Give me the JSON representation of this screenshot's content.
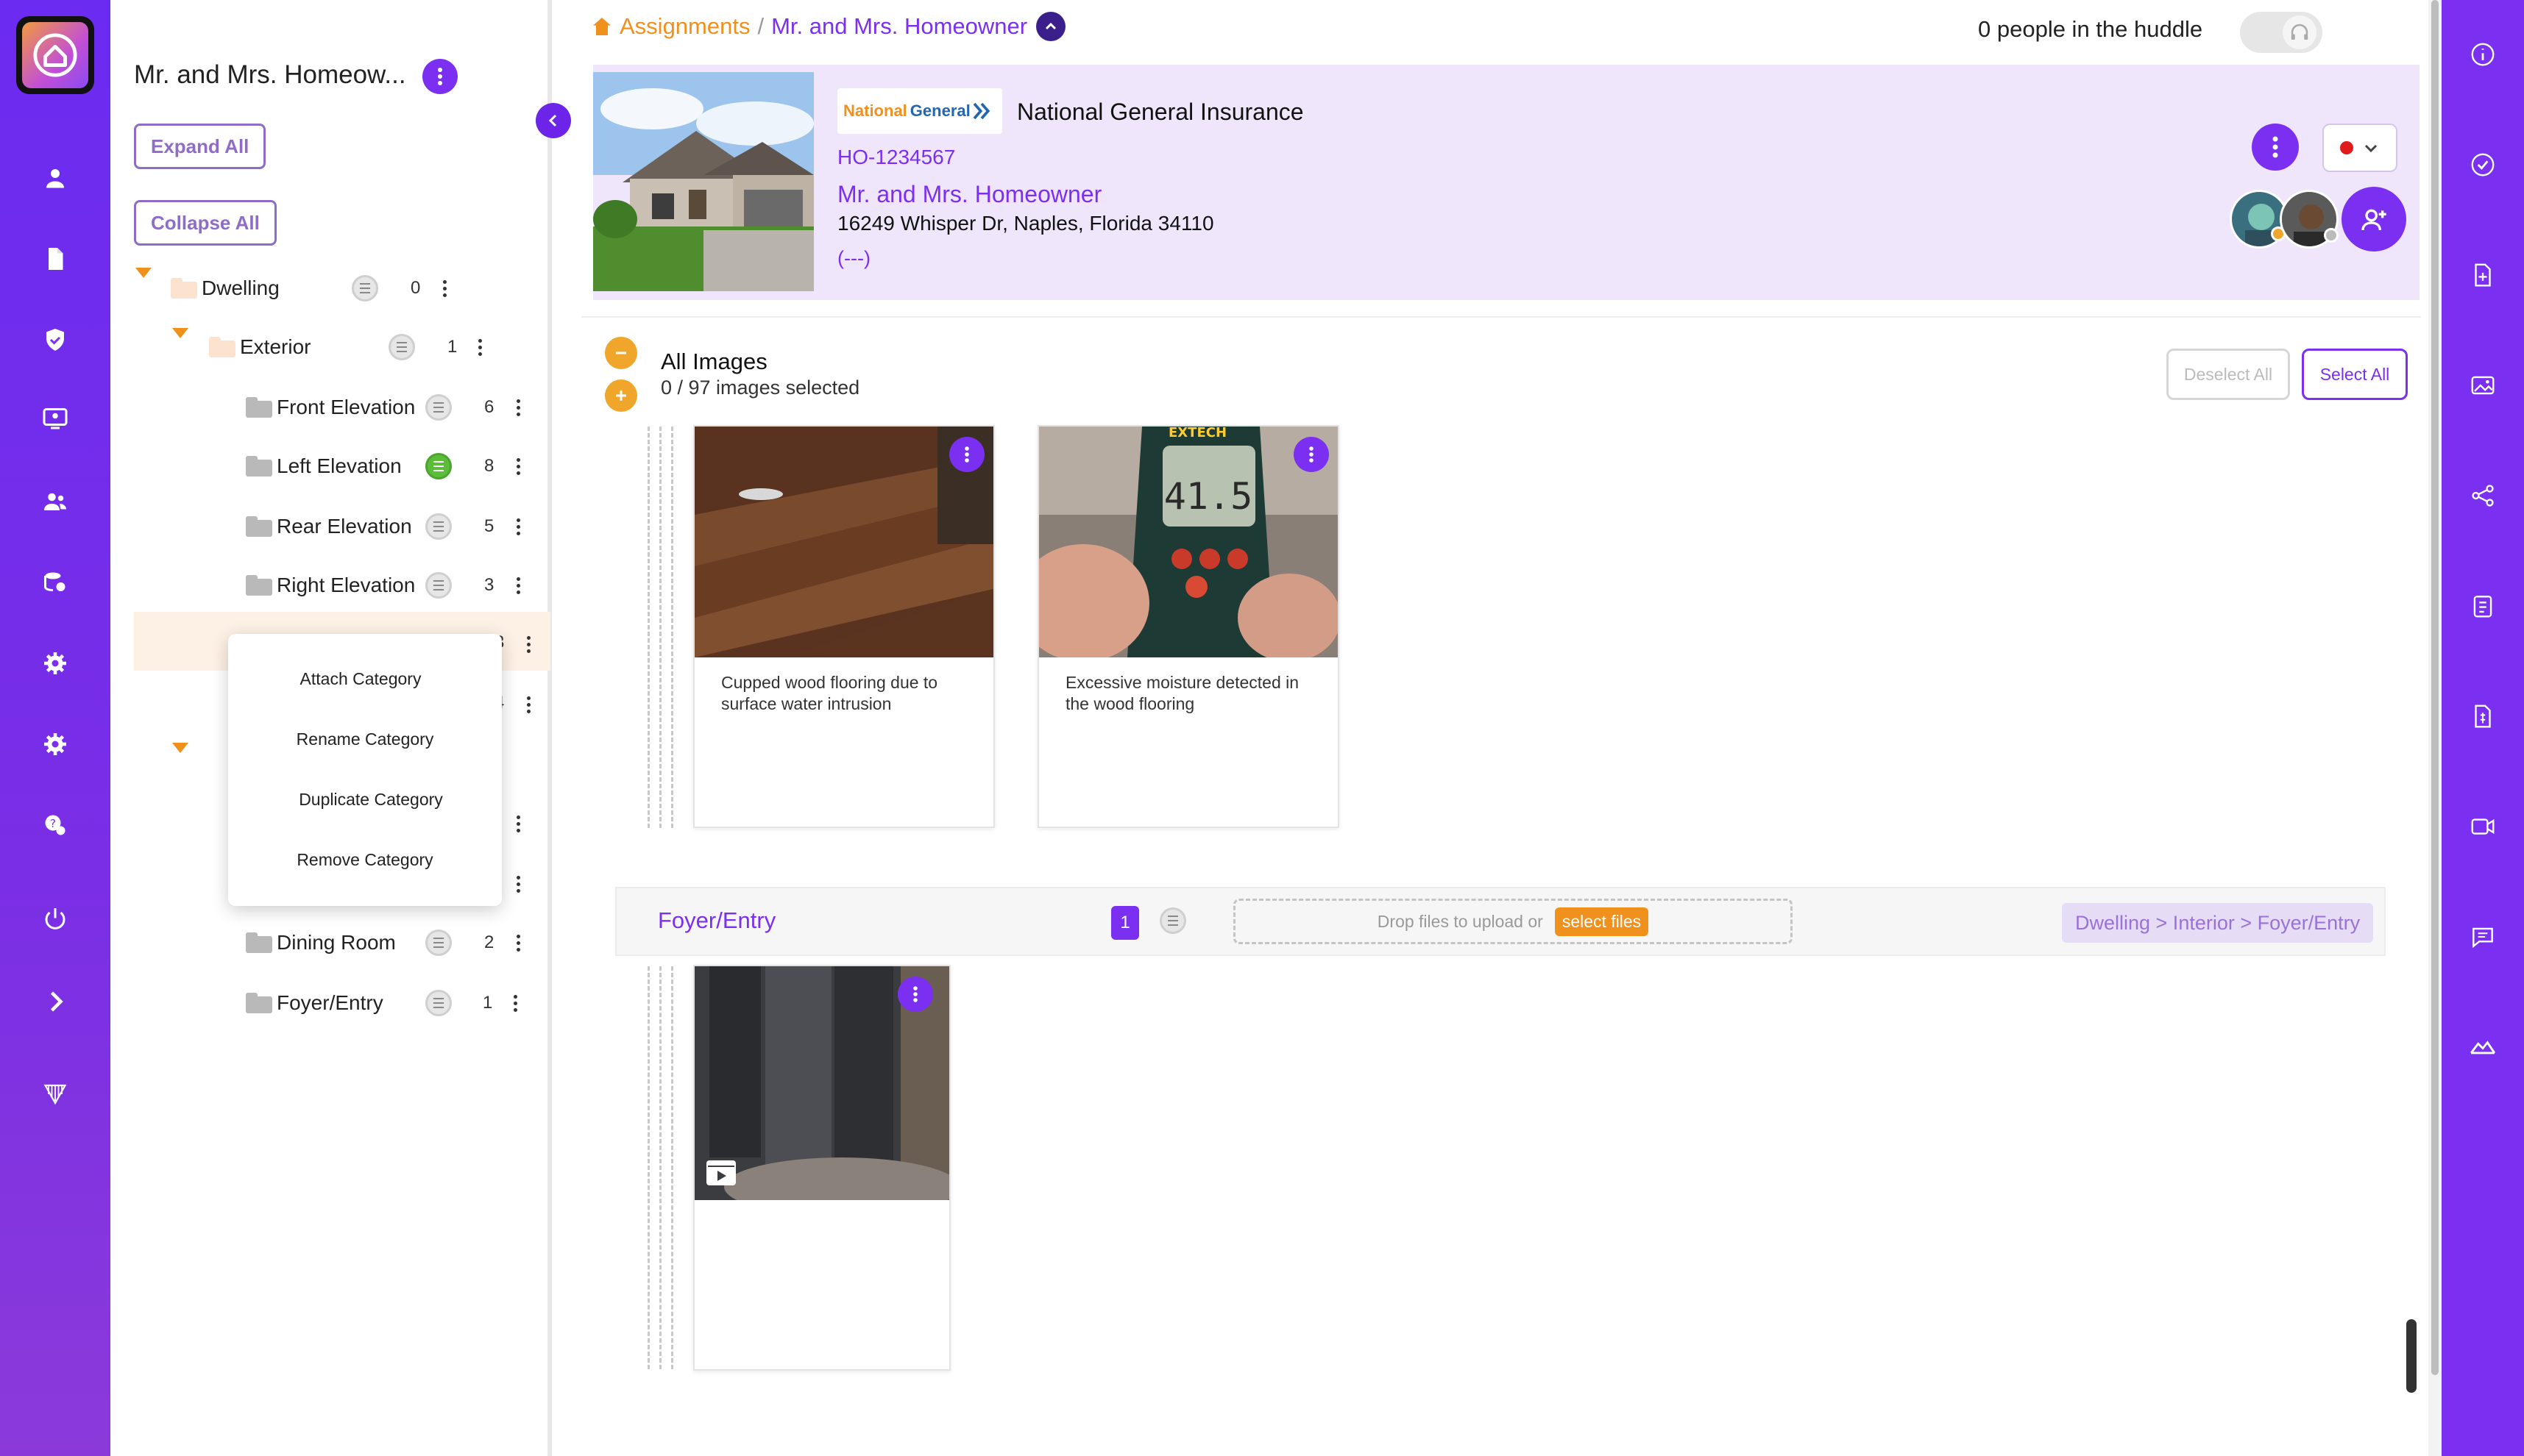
{
  "header": {
    "breadcrumb_root": "Assignments",
    "breadcrumb_sep": "/",
    "breadcrumb_current": "Mr. and Mrs. Homeowner",
    "huddle_text": "0 people in the huddle"
  },
  "claim": {
    "carrier_logo_word1": "National",
    "carrier_logo_word2": "General",
    "carrier_name": "National General Insurance",
    "policy_number": "HO-1234567",
    "insured_name": "Mr. and Mrs. Homeowner",
    "address": "16249 Whisper Dr, Naples, Florida 34110",
    "phone": "(---)",
    "status_color": "#e01b1b"
  },
  "sidebar": {
    "title": "Mr. and Mrs. Homeow...",
    "expand_all": "Expand All",
    "collapse_all": "Collapse All",
    "tree": [
      {
        "label": "Dwelling",
        "count": "0"
      },
      {
        "label": "Exterior",
        "count": "1"
      },
      {
        "label": "Front Elevation",
        "count": "6"
      },
      {
        "label": "Left Elevation",
        "count": "8"
      },
      {
        "label": "Rear Elevation",
        "count": "5"
      },
      {
        "label": "Right Elevation",
        "count": "3"
      },
      {
        "label": "Dining Room",
        "count": "2"
      },
      {
        "label": "Foyer/Entry",
        "count": "1"
      }
    ],
    "hidden_counts": [
      "3",
      "4"
    ],
    "context_menu": [
      "Attach Category",
      "Rename Category",
      "Duplicate Category",
      "Remove Category"
    ]
  },
  "main": {
    "all_images_title": "All Images",
    "images_selected": "0 / 97 images selected",
    "deselect_all": "Deselect All",
    "select_all": "Select All",
    "images": [
      {
        "caption": "Cupped wood flooring due to surface water intrusion"
      },
      {
        "caption": "Excessive moisture detected in the wood flooring",
        "meter_reading": "41.5",
        "meter_brand": "EXTECH"
      }
    ],
    "section": {
      "title": "Foyer/Entry",
      "count": "1",
      "drop_text": "Drop files to upload or",
      "select_files": "select files",
      "path": "Dwelling > Interior > Foyer/Entry"
    }
  },
  "icons": {
    "left_rail": [
      "user-icon",
      "document-icon",
      "shield-check-icon",
      "monitor-user-icon",
      "users-icon",
      "database-settings-icon",
      "gear-icon",
      "gear-alt-icon",
      "help-chat-icon",
      "power-icon",
      "chevron-right-icon",
      "brand-mark-icon"
    ],
    "right_rail": [
      "info-icon",
      "check-circle-icon",
      "file-plus-icon",
      "images-icon",
      "share-icon",
      "clipboard-icon",
      "file-dollar-icon",
      "video-icon",
      "chat-icon",
      "roof-icon"
    ]
  },
  "colors": {
    "brand_purple": "#7b2ff0",
    "accent_orange": "#f0901d",
    "card_lavender": "#efe6fb"
  }
}
